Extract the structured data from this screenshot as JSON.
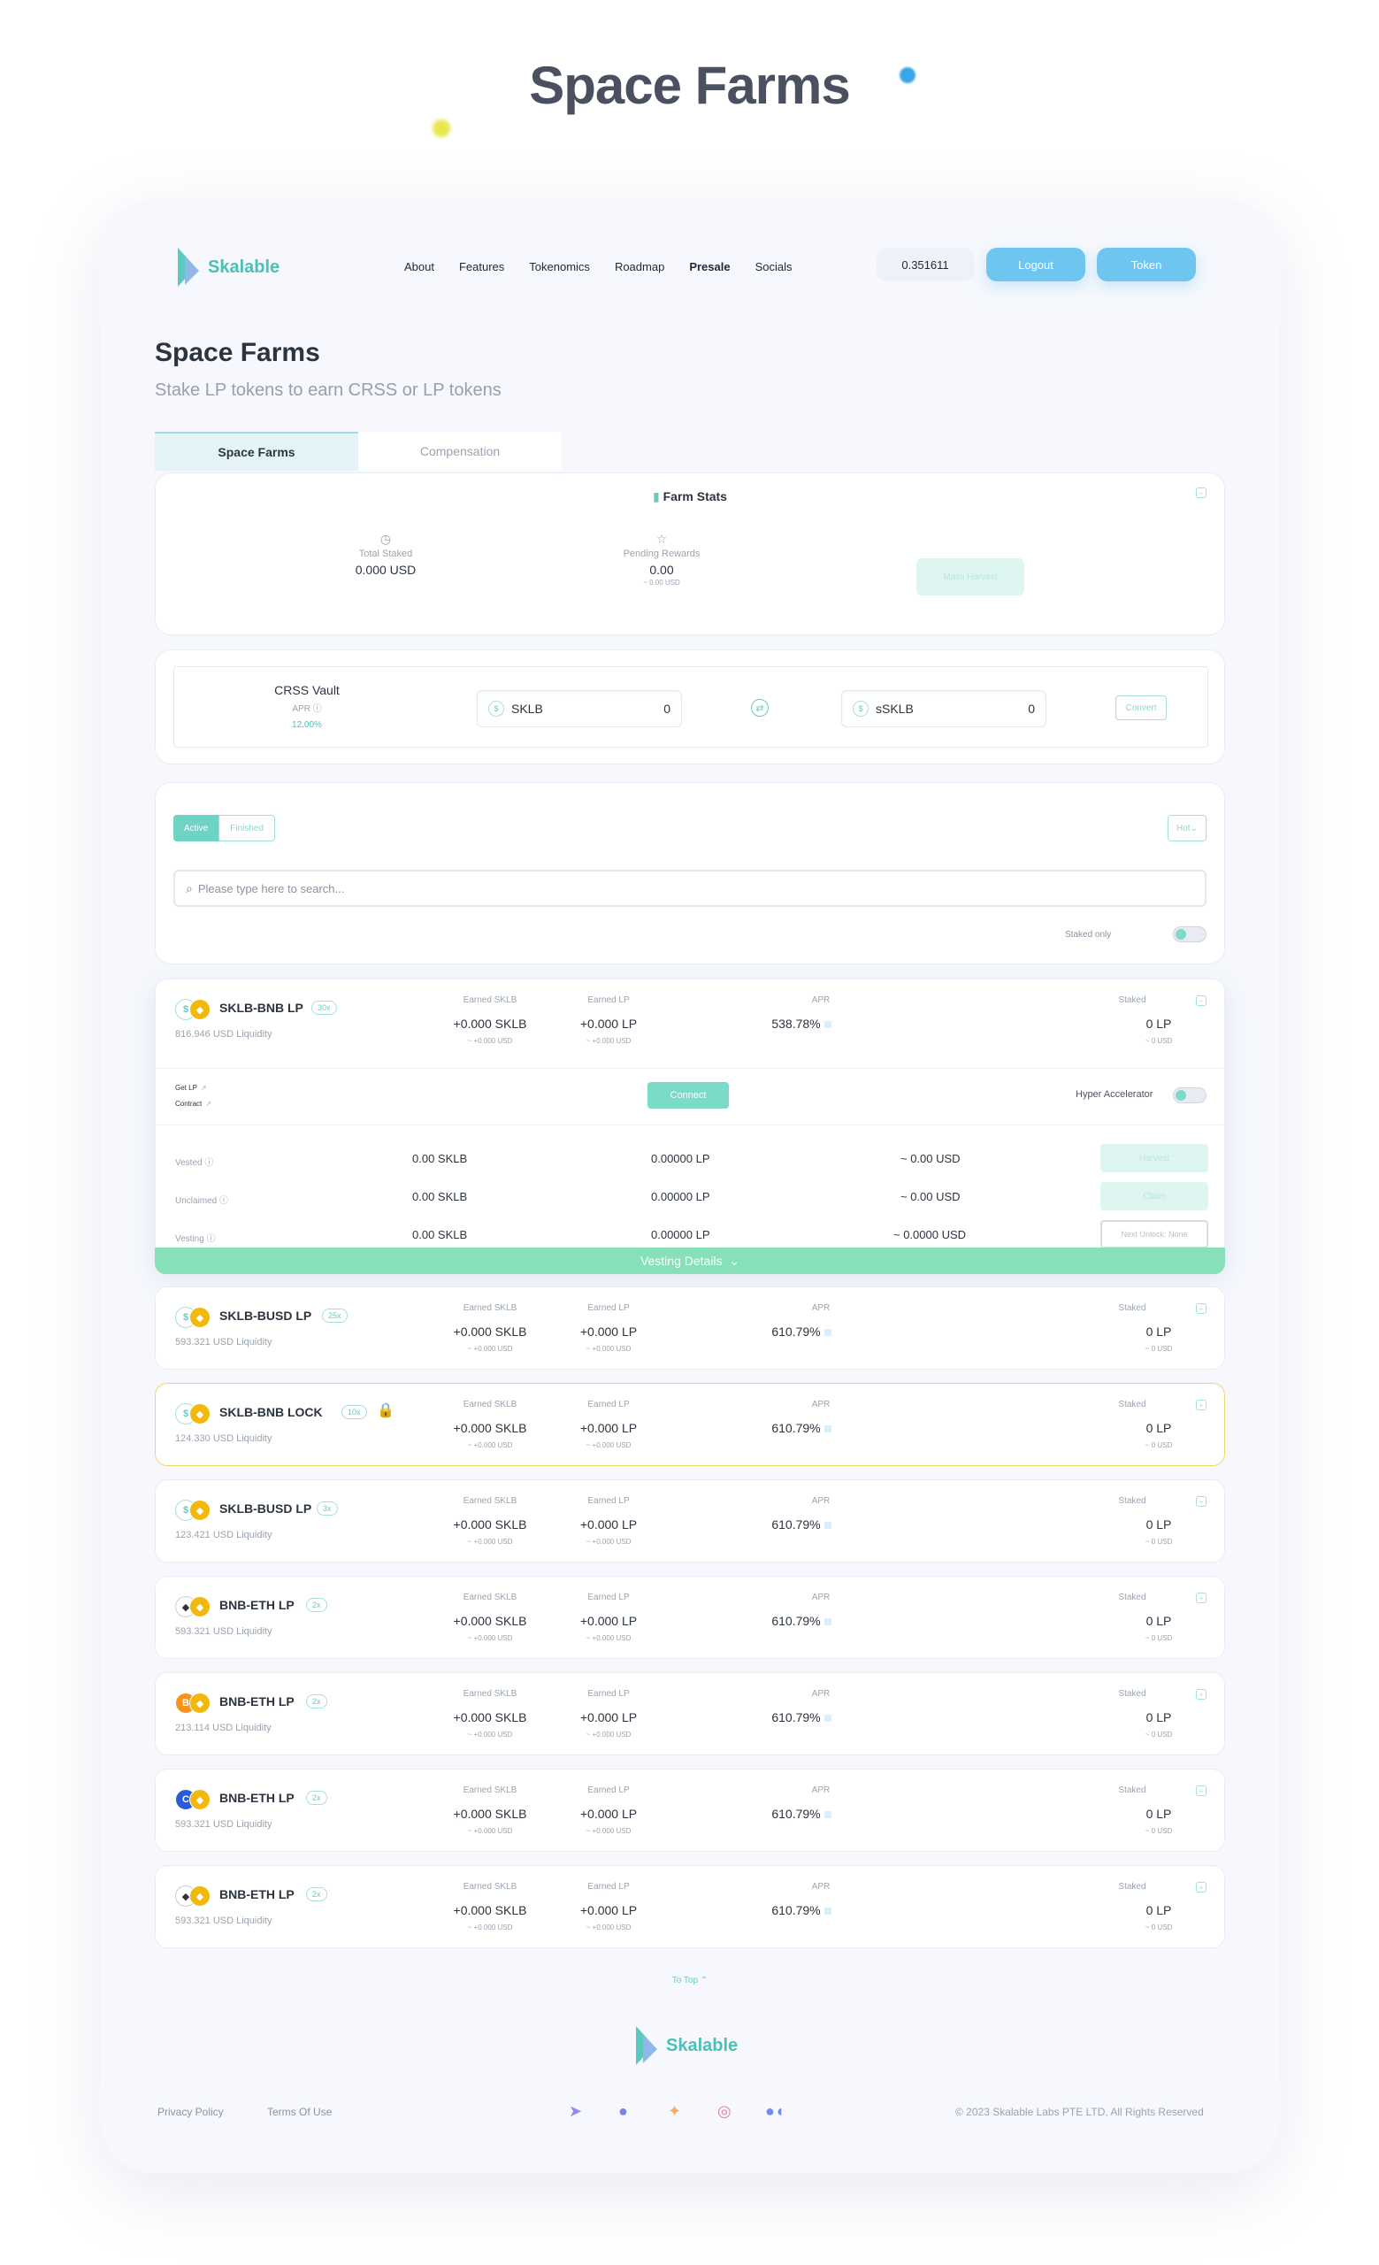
{
  "hero": {
    "title": "Space Farms"
  },
  "header": {
    "brand": "Skalable",
    "nav": [
      "About",
      "Features",
      "Tokenomics",
      "Roadmap",
      "Presale",
      "Socials"
    ],
    "price": "0.351611",
    "logout_label": "Logout",
    "token_label": "Token"
  },
  "page": {
    "title": "Space Farms",
    "subtitle": "Stake LP tokens to earn CRSS or LP tokens"
  },
  "tabs": [
    "Space Farms",
    "Compensation"
  ],
  "farm_stats": {
    "title": "Farm Stats",
    "total_staked_label": "Total Staked",
    "total_staked_value": "0.000 USD",
    "pending_label": "Pending Rewards",
    "pending_value": "0.00",
    "pending_sub": "~ 0.00 USD",
    "mass_harvest_label": "Mass Harvest"
  },
  "vault": {
    "name": "CRSS Vault",
    "apr_label": "APR",
    "apr_value": "12.00%",
    "from_token": "SKLB",
    "from_amount": "0",
    "to_token": "sSKLB",
    "to_amount": "0",
    "convert_label": "Convert"
  },
  "filters": {
    "active_label": "Active",
    "finished_label": "Finished",
    "sort_label": "Hot",
    "search_placeholder": "Please type here to search...",
    "staked_only_label": "Staked only"
  },
  "columns": {
    "earned_sklb": "Earned SKLB",
    "earned_lp": "Earned LP",
    "apr": "APR",
    "staked": "Staked"
  },
  "expanded_farm": {
    "name": "SKLB-BNB LP",
    "mult": "30x",
    "liquidity": "816.946 USD Liquidity",
    "earned_sklb": "+0.000 SKLB",
    "earned_sklb_sub": "~ +0.000 USD",
    "earned_lp": "+0.000 LP",
    "earned_lp_sub": "~ +0.000 USD",
    "apr": "538.78%",
    "staked": "0 LP",
    "staked_sub": "~ 0 USD",
    "get_lp": "Get LP",
    "contract": "Contract",
    "connect_label": "Connect",
    "hyper_label": "Hyper Accelerator",
    "rows": [
      {
        "label": "Vested",
        "sklb": "0.00 SKLB",
        "lp": "0.00000 LP",
        "usd": "~ 0.00 USD",
        "btn": "Harvest"
      },
      {
        "label": "Unclaimed",
        "sklb": "0.00 SKLB",
        "lp": "0.00000 LP",
        "usd": "~ 0.00 USD",
        "btn": "Claim"
      },
      {
        "label": "Vesting",
        "sklb": "0.00 SKLB",
        "lp": "0.00000 LP",
        "usd": "~ 0.0000 USD",
        "btn": "Next Unlock: None"
      }
    ],
    "vesting_details_label": "Vesting Details"
  },
  "farms": [
    {
      "name": "SKLB-BUSD LP",
      "mult": "25x",
      "liquidity": "593.321 USD Liquidity",
      "earned_sklb": "+0.000 SKLB",
      "earned_sklb_sub": "~ +0.000 USD",
      "earned_lp": "+0.000 LP",
      "earned_lp_sub": "~ +0.000 USD",
      "apr": "610.79%",
      "staked": "0 LP",
      "staked_sub": "~ 0 USD",
      "coin_a": "$",
      "coin_b": "◆"
    },
    {
      "name": "SKLB-BNB LOCK",
      "mult": "10x",
      "liquidity": "124.330 USD Liquidity",
      "earned_sklb": "+0.000 SKLB",
      "earned_sklb_sub": "~ +0.000 USD",
      "earned_lp": "+0.000 LP",
      "earned_lp_sub": "~ +0.000 USD",
      "apr": "610.79%",
      "staked": "0 LP",
      "staked_sub": "~ 0 USD",
      "coin_a": "$",
      "coin_b": "◆"
    },
    {
      "name": "SKLB-BUSD LP",
      "mult": "3x",
      "liquidity": "123.421 USD Liquidity",
      "earned_sklb": "+0.000 SKLB",
      "earned_sklb_sub": "~ +0.000 USD",
      "earned_lp": "+0.000 LP",
      "earned_lp_sub": "~ +0.000 USD",
      "apr": "610.79%",
      "staked": "0 LP",
      "staked_sub": "~ 0 USD",
      "coin_a": "$",
      "coin_b": "◆"
    },
    {
      "name": "BNB-ETH LP",
      "mult": "2x",
      "liquidity": "593.321 USD Liquidity",
      "earned_sklb": "+0.000 SKLB",
      "earned_sklb_sub": "~ +0.000 USD",
      "earned_lp": "+0.000 LP",
      "earned_lp_sub": "~ +0.000 USD",
      "apr": "610.79%",
      "staked": "0 LP",
      "staked_sub": "~ 0 USD",
      "coin_a": "◆",
      "coin_b": "◆"
    },
    {
      "name": "BNB-ETH LP",
      "mult": "2x",
      "liquidity": "213.114 USD Liquidity",
      "earned_sklb": "+0.000 SKLB",
      "earned_sklb_sub": "~ +0.000 USD",
      "earned_lp": "+0.000 LP",
      "earned_lp_sub": "~ +0.000 USD",
      "apr": "610.79%",
      "staked": "0 LP",
      "staked_sub": "~ 0 USD",
      "coin_a": "B",
      "coin_b": "◆"
    },
    {
      "name": "BNB-ETH LP",
      "mult": "2x",
      "liquidity": "593.321 USD Liquidity",
      "earned_sklb": "+0.000 SKLB",
      "earned_sklb_sub": "~ +0.000 USD",
      "earned_lp": "+0.000 LP",
      "earned_lp_sub": "~ +0.000 USD",
      "apr": "610.79%",
      "staked": "0 LP",
      "staked_sub": "~ 0 USD",
      "coin_a": "C",
      "coin_b": "◆"
    },
    {
      "name": "BNB-ETH LP",
      "mult": "2x",
      "liquidity": "593.321 USD Liquidity",
      "earned_sklb": "+0.000 SKLB",
      "earned_sklb_sub": "~ +0.000 USD",
      "earned_lp": "+0.000 LP",
      "earned_lp_sub": "~ +0.000 USD",
      "apr": "610.79%",
      "staked": "0 LP",
      "staked_sub": "~ 0 USD",
      "coin_a": "◆",
      "coin_b": "◆"
    }
  ],
  "footer": {
    "to_top": "To Top ⌃",
    "brand": "Skalable",
    "privacy": "Privacy Policy",
    "terms": "Terms Of Use",
    "copyright": "© 2023 Skalable Labs PTE LTD, All Rights Reserved"
  }
}
